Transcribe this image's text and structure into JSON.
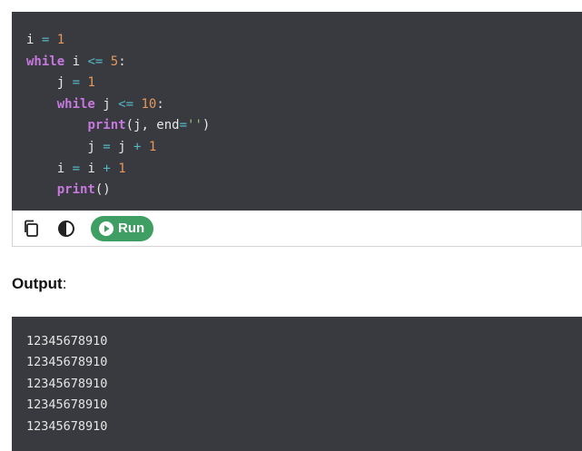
{
  "code": {
    "lines": [
      [
        {
          "t": "ident",
          "v": "i "
        },
        {
          "t": "op",
          "v": "="
        },
        {
          "t": "ident",
          "v": " "
        },
        {
          "t": "num",
          "v": "1"
        }
      ],
      [
        {
          "t": "kw",
          "v": "while"
        },
        {
          "t": "ident",
          "v": " i "
        },
        {
          "t": "op",
          "v": "<="
        },
        {
          "t": "ident",
          "v": " "
        },
        {
          "t": "num",
          "v": "5"
        },
        {
          "t": "ident",
          "v": ":"
        }
      ],
      [
        {
          "t": "ident",
          "v": "    j "
        },
        {
          "t": "op",
          "v": "="
        },
        {
          "t": "ident",
          "v": " "
        },
        {
          "t": "num",
          "v": "1"
        }
      ],
      [
        {
          "t": "ident",
          "v": "    "
        },
        {
          "t": "kw",
          "v": "while"
        },
        {
          "t": "ident",
          "v": " j "
        },
        {
          "t": "op",
          "v": "<="
        },
        {
          "t": "ident",
          "v": " "
        },
        {
          "t": "num",
          "v": "10"
        },
        {
          "t": "ident",
          "v": ":"
        }
      ],
      [
        {
          "t": "ident",
          "v": "        "
        },
        {
          "t": "fn",
          "v": "print"
        },
        {
          "t": "ident",
          "v": "(j, end"
        },
        {
          "t": "op",
          "v": "="
        },
        {
          "t": "str",
          "v": "''"
        },
        {
          "t": "ident",
          "v": ")"
        }
      ],
      [
        {
          "t": "ident",
          "v": "        j "
        },
        {
          "t": "op",
          "v": "="
        },
        {
          "t": "ident",
          "v": " j "
        },
        {
          "t": "op",
          "v": "+"
        },
        {
          "t": "ident",
          "v": " "
        },
        {
          "t": "num",
          "v": "1"
        }
      ],
      [
        {
          "t": "ident",
          "v": "    i "
        },
        {
          "t": "op",
          "v": "="
        },
        {
          "t": "ident",
          "v": " i "
        },
        {
          "t": "op",
          "v": "+"
        },
        {
          "t": "ident",
          "v": " "
        },
        {
          "t": "num",
          "v": "1"
        }
      ],
      [
        {
          "t": "ident",
          "v": "    "
        },
        {
          "t": "fn",
          "v": "print"
        },
        {
          "t": "ident",
          "v": "()"
        }
      ]
    ]
  },
  "toolbar": {
    "copy_icon": "copy-icon",
    "theme_icon": "contrast-icon",
    "run_icon": "play-icon",
    "run_label": "Run"
  },
  "output": {
    "label": "Output",
    "label_suffix": ":",
    "lines": [
      "12345678910",
      "12345678910",
      "12345678910",
      "12345678910",
      "12345678910"
    ]
  },
  "colors": {
    "code_bg": "#383a40",
    "keyword": "#c678dd",
    "number": "#e5985a",
    "operator": "#56b6c2",
    "string": "#98c379",
    "run_button": "#3f9e63"
  }
}
